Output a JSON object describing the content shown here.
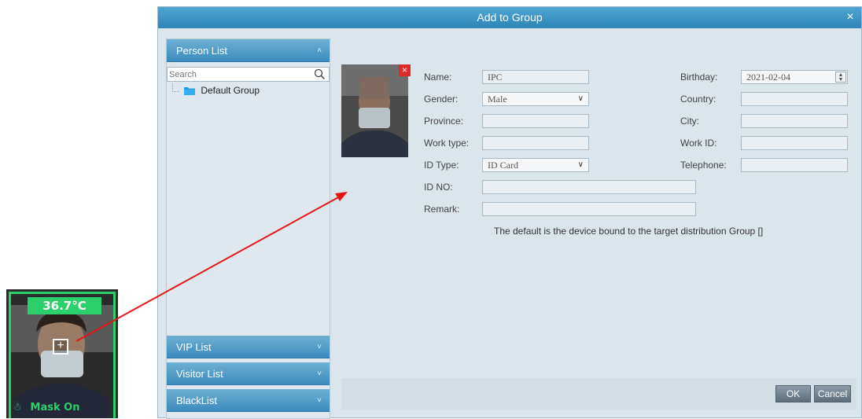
{
  "dialog": {
    "title": "Add to Group",
    "close_glyph": "×",
    "close_icon": "close-icon"
  },
  "left_panel": {
    "person_list_label": "Person List",
    "search_placeholder": "Search",
    "tree": [
      {
        "label": "Default Group",
        "icon": "folder-icon"
      }
    ],
    "vip_list_label": "VIP List",
    "visitor_list_label": "Visitor List",
    "blacklist_label": "BlackList"
  },
  "photo": {
    "remove_glyph": "×"
  },
  "form": {
    "name_label": "Name:",
    "name_value": "IPC",
    "gender_label": "Gender:",
    "gender_value": "Male",
    "province_label": "Province:",
    "province_value": "",
    "work_type_label": "Work type:",
    "work_type_value": "",
    "id_type_label": "ID Type:",
    "id_type_value": "ID Card",
    "id_no_label": "ID NO:",
    "id_no_value": "",
    "remark_label": "Remark:",
    "remark_value": "",
    "birthday_label": "Birthday:",
    "birthday_value": "2021-02-04",
    "country_label": "Country:",
    "country_value": "",
    "city_label": "City:",
    "city_value": "",
    "work_id_label": "Work ID:",
    "work_id_value": "",
    "telephone_label": "Telephone:",
    "telephone_value": "",
    "note": "The default is the device bound to the target distribution Group []"
  },
  "buttons": {
    "ok": "OK",
    "cancel": "Cancel"
  },
  "camera_tile": {
    "temperature": "36.7°C",
    "mask_status": "Mask On",
    "add_glyph": "+"
  },
  "colors": {
    "accent": "#3b8bbd",
    "status_green": "#2bd06a",
    "remove_red": "#e0292b",
    "arrow_red": "#e8141a"
  }
}
